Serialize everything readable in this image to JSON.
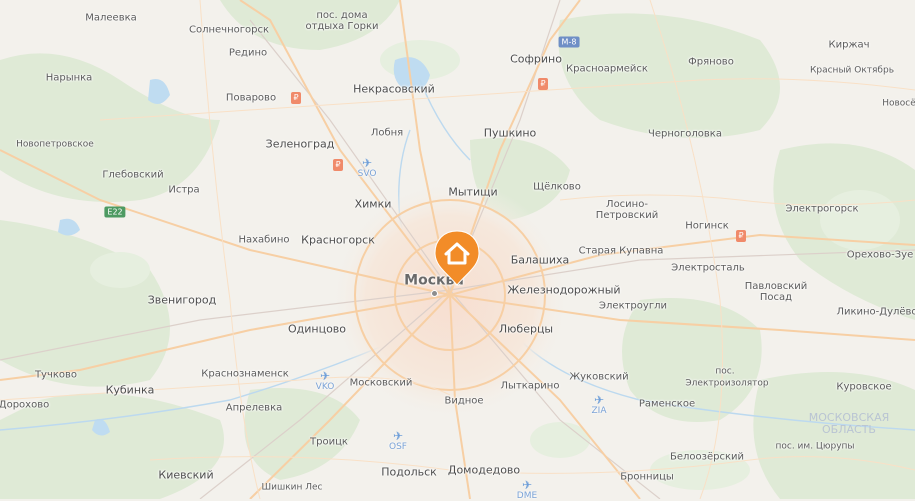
{
  "colors": {
    "land": "#f3f1ec",
    "forest": "#dde9d4",
    "water": "#b8d6ee",
    "road_major": "#f6c79b",
    "road_minor": "#f8d9b5",
    "rail": "#d7c9c3",
    "city_area": "#f6e6d9",
    "pin": "#f08a2b",
    "region_text": "#b9c4d3"
  },
  "marker": {
    "icon": "house-icon"
  },
  "labels": [
    {
      "key": "maleevka",
      "text": "Малеевка"
    },
    {
      "key": "solnechnogorsk",
      "text": "Солнечногорск"
    },
    {
      "key": "redino",
      "text": "Редино"
    },
    {
      "key": "gorki",
      "text": "пос. дома\nотдыха Горки"
    },
    {
      "key": "nakhabino",
      "text": "Нахабино"
    },
    {
      "key": "narynka",
      "text": "Нарынка"
    },
    {
      "key": "povarovo",
      "text": "Поварово"
    },
    {
      "key": "nekrasovsky",
      "text": "Некрасовский"
    },
    {
      "key": "sofrino",
      "text": "Софрино"
    },
    {
      "key": "krasnoarmeysk",
      "text": "Красноармейск"
    },
    {
      "key": "fryanovo",
      "text": "Фряново"
    },
    {
      "key": "kirzhach",
      "text": "Киржач"
    },
    {
      "key": "krasny_oktyabr",
      "text": "Красный Октябрь"
    },
    {
      "key": "novos",
      "text": "Новосё"
    },
    {
      "key": "novopetrovskoe",
      "text": "Новопетровское"
    },
    {
      "key": "zelenograd",
      "text": "Зеленоград"
    },
    {
      "key": "lobnya",
      "text": "Лобня"
    },
    {
      "key": "pushkino",
      "text": "Пушкино"
    },
    {
      "key": "chernogolovka",
      "text": "Черноголовка"
    },
    {
      "key": "glebovsky",
      "text": "Глебовский"
    },
    {
      "key": "istra",
      "text": "Истра"
    },
    {
      "key": "mytishchi",
      "text": "Мытищи"
    },
    {
      "key": "shchyolkovo",
      "text": "Щёлково"
    },
    {
      "key": "losino",
      "text": "Лосино-\nПетровский"
    },
    {
      "key": "khimki",
      "text": "Химки"
    },
    {
      "key": "noginsk",
      "text": "Ногинск"
    },
    {
      "key": "elektrogorsk",
      "text": "Электрогорск"
    },
    {
      "key": "krasnogorsk",
      "text": "Красногорск"
    },
    {
      "key": "staraya_kupavna",
      "text": "Старая Купавна"
    },
    {
      "key": "balashikha",
      "text": "Балашиха"
    },
    {
      "key": "orekhovo",
      "text": "Орехово-Зуе"
    },
    {
      "key": "moskva",
      "text": "Москва"
    },
    {
      "key": "elektrostal",
      "text": "Электросталь"
    },
    {
      "key": "zheleznodorozhny",
      "text": "Железнодорожный"
    },
    {
      "key": "pavlovsky_posad",
      "text": "Павловский\nПосад"
    },
    {
      "key": "zvenigorod",
      "text": "Звенигород"
    },
    {
      "key": "elektrougli",
      "text": "Электроугли"
    },
    {
      "key": "likino",
      "text": "Ликино-Дулёво"
    },
    {
      "key": "odintsovo",
      "text": "Одинцово"
    },
    {
      "key": "lyubertsy",
      "text": "Люберцы"
    },
    {
      "key": "pos_short",
      "text": "пос."
    },
    {
      "key": "tuchkovo",
      "text": "Тучково"
    },
    {
      "key": "krasnoznamensk",
      "text": "Краснознаменск"
    },
    {
      "key": "zhukovsky",
      "text": "Жуковский"
    },
    {
      "key": "elektroizolyator",
      "text": "Электроизолятор"
    },
    {
      "key": "kubinka",
      "text": "Кубинка"
    },
    {
      "key": "moskovsky",
      "text": "Московский"
    },
    {
      "key": "lytkarino",
      "text": "Лыткарино"
    },
    {
      "key": "kurovskoe",
      "text": "Куровское"
    },
    {
      "key": "dorokhovo",
      "text": "Дорохово"
    },
    {
      "key": "aprelevka",
      "text": "Апрелевка"
    },
    {
      "key": "vidnoe",
      "text": "Видное"
    },
    {
      "key": "ramenskoe",
      "text": "Раменское"
    },
    {
      "key": "region",
      "text": "МОСКОВСКАЯ\nОБЛАСТЬ"
    },
    {
      "key": "troitsk",
      "text": "Троицк"
    },
    {
      "key": "tsyurupy",
      "text": "пос. им. Цюрупы"
    },
    {
      "key": "belozyorsky",
      "text": "Белоозёрский"
    },
    {
      "key": "podolsk",
      "text": "Подольск"
    },
    {
      "key": "domodedovo",
      "text": "Домодедово"
    },
    {
      "key": "kievsky",
      "text": "Киевский"
    },
    {
      "key": "bronnitsy",
      "text": "Бронницы"
    },
    {
      "key": "shishkin_les",
      "text": "Шишкин Лес"
    }
  ],
  "airports": [
    {
      "key": "svo",
      "code": "SVO"
    },
    {
      "key": "vko",
      "code": "VKO"
    },
    {
      "key": "zia",
      "code": "ZIA"
    },
    {
      "key": "osf",
      "code": "OSF"
    },
    {
      "key": "dme",
      "code": "DME"
    }
  ],
  "shields": [
    {
      "key": "m8",
      "text": "M-8"
    },
    {
      "key": "e22",
      "text": "E22"
    }
  ]
}
